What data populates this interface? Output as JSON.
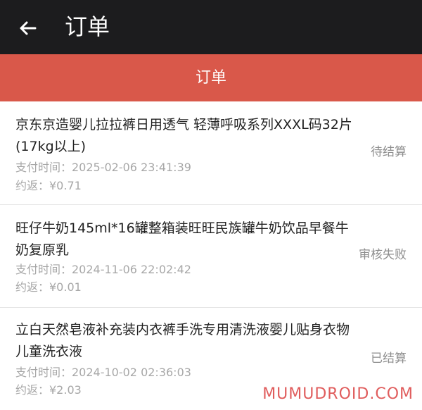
{
  "topbar": {
    "title": "订单",
    "back_icon": "arrow-left-icon"
  },
  "header": {
    "title": "订单"
  },
  "orders": [
    {
      "title": "京东京造婴儿拉拉裤日用透气 轻薄呼吸系列XXXL码32片(17kg以上)",
      "paytime": "支付时间：2025-02-06 23:41:39",
      "rebate": "约返：¥0.71",
      "status": "待结算"
    },
    {
      "title": "旺仔牛奶145ml*16罐整箱装旺旺民族罐牛奶饮品早餐牛奶复原乳",
      "paytime": "支付时间：2024-11-06 22:02:42",
      "rebate": "约返：¥0.01",
      "status": "审核失败"
    },
    {
      "title": "立白天然皂液补充装内衣裤手洗专用清洗液婴儿贴身衣物儿童洗衣液",
      "paytime": "支付时间：2024-10-02 02:36:03",
      "rebate": "约返：¥2.03",
      "status": "已结算"
    }
  ],
  "watermark": "MUMUDROID.COM",
  "colors": {
    "topbar": "#1c1c1e",
    "header": "#d9584a",
    "muted_text": "#a7a7a7",
    "status_text": "#8d8d8d",
    "watermark": "#e05d5d"
  }
}
